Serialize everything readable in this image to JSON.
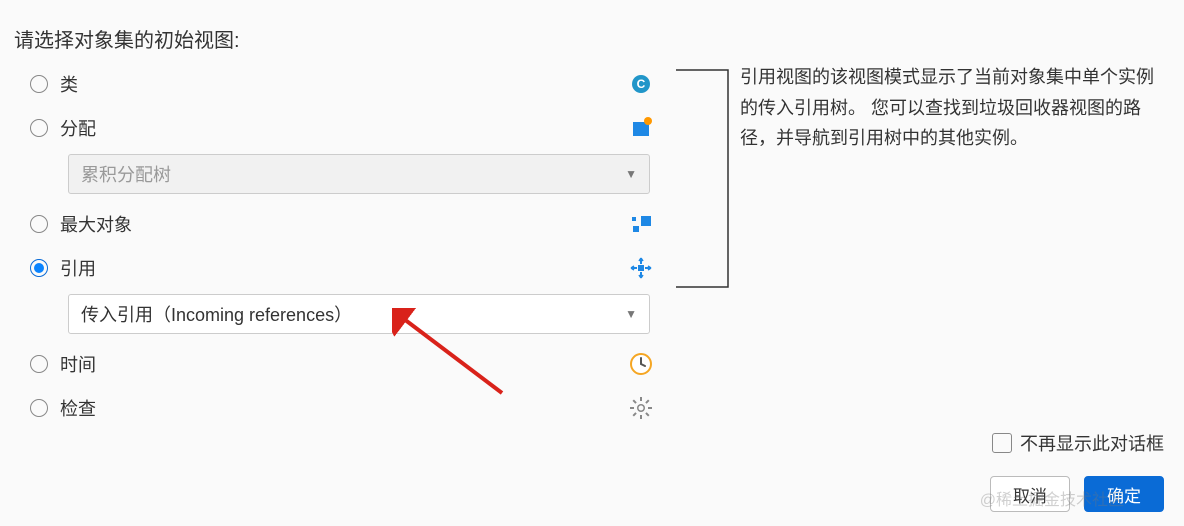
{
  "prompt_title": "请选择对象集的初始视图:",
  "options": {
    "class": {
      "label": "类",
      "selected": false
    },
    "allocation": {
      "label": "分配",
      "selected": false
    },
    "allocation_dropdown": {
      "text": "累积分配树",
      "disabled": true
    },
    "biggest": {
      "label": "最大对象",
      "selected": false
    },
    "references": {
      "label": "引用",
      "selected": true
    },
    "references_dropdown": {
      "text": "传入引用（Incoming references）",
      "disabled": false
    },
    "time": {
      "label": "时间",
      "selected": false
    },
    "inspect": {
      "label": "检查",
      "selected": false
    }
  },
  "description": "引用视图的该视图模式显示了当前对象集中单个实例的传入引用树。 您可以查找到垃圾回收器视图的路径，并导航到引用树中的其他实例。",
  "footer": {
    "do_not_show_label": "不再显示此对话框",
    "cancel": "取消",
    "ok": "确定"
  },
  "watermark": "@稀土掘金技术社区"
}
